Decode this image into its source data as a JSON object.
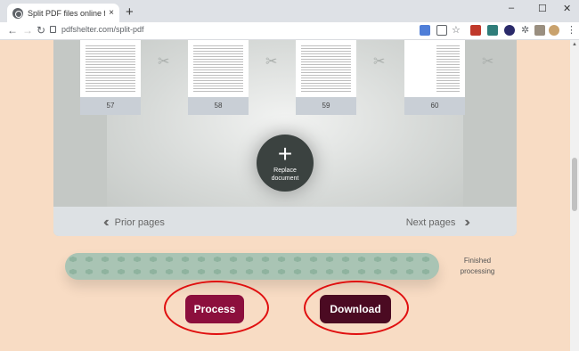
{
  "browser": {
    "tab_title": "Split PDF files online for free, wit",
    "tab_close": "×",
    "new_tab": "+",
    "window_controls": [
      "–",
      "☐",
      "✕"
    ],
    "url": "pdfshelter.com/split-pdf",
    "nav": {
      "back": "←",
      "forward": "→",
      "reload": "↻"
    }
  },
  "viewer": {
    "pages": [
      {
        "number": "57"
      },
      {
        "number": "58"
      },
      {
        "number": "59"
      },
      {
        "number": "60"
      }
    ],
    "replace_label_line1": "Replace",
    "replace_label_line2": "document",
    "replace_icon": "+",
    "prior_label": "Prior pages",
    "next_label": "Next pages"
  },
  "progress": {
    "value_pct": 100,
    "status_line1": "Finished",
    "status_line2": "processing"
  },
  "actions": {
    "process_label": "Process",
    "download_label": "Download"
  },
  "colors": {
    "page_bg": "#f8dcc4",
    "process_btn": "#8c0f3d",
    "download_btn": "#4b0a22",
    "annotation_ring": "#e01010"
  }
}
